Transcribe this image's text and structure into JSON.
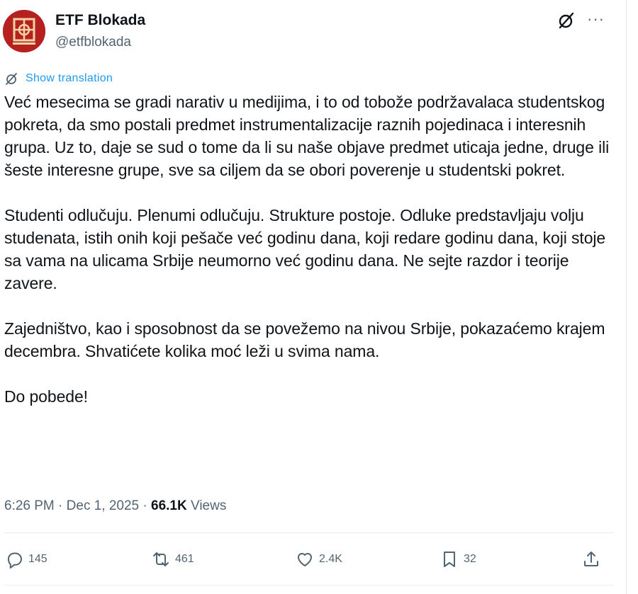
{
  "author": {
    "name": "ETF Blokada",
    "handle": "@etfblokada",
    "avatar_icon": "etf-logo-icon"
  },
  "header": {
    "grok_icon": "grok-icon",
    "more_icon": "more-options-icon",
    "more_label": "···"
  },
  "translation": {
    "label": "Show translation",
    "icon": "translate-icon"
  },
  "post": {
    "paragraphs": [
      "Već mesecima se gradi narativ u medijima, i to od tobože podržavalaca studentskog pokreta, da smo postali predmet instrumentalizacije raznih pojedinaca i interesnih grupa. Uz to, daje se sud o tome da li su naše objave predmet uticaja jedne, druge ili šeste interesne grupe, sve sa ciljem da se obori poverenje u studentski pokret.",
      "Studenti odlučuju. Plenumi odlučuju. Strukture postoje. Odluke predstavljaju volju studenata, istih onih koji pešače već godinu dana, koji redare godinu dana, koji stoje sa vama na ulicama Srbije neumorno već godinu dana. Ne sejte razdor i teorije zavere.",
      "Zajedništvo, kao i sposobnost da se povežemo na nivou Srbije, pokazaćemo krajem decembra. Shvatićete kolika moć leži u svima nama.",
      "Do pobede!"
    ]
  },
  "meta": {
    "time": "6:26 PM",
    "separator": "·",
    "date": "Dec 1, 2025",
    "views_count": "66.1K",
    "views_label": "Views"
  },
  "actions": {
    "replies": "145",
    "reposts": "461",
    "likes": "2.4K",
    "bookmarks": "32"
  },
  "colors": {
    "accent": "#1d9bf0",
    "secondary_text": "#536471",
    "primary_text": "#0f1419",
    "avatar_bg": "#b5211f"
  }
}
